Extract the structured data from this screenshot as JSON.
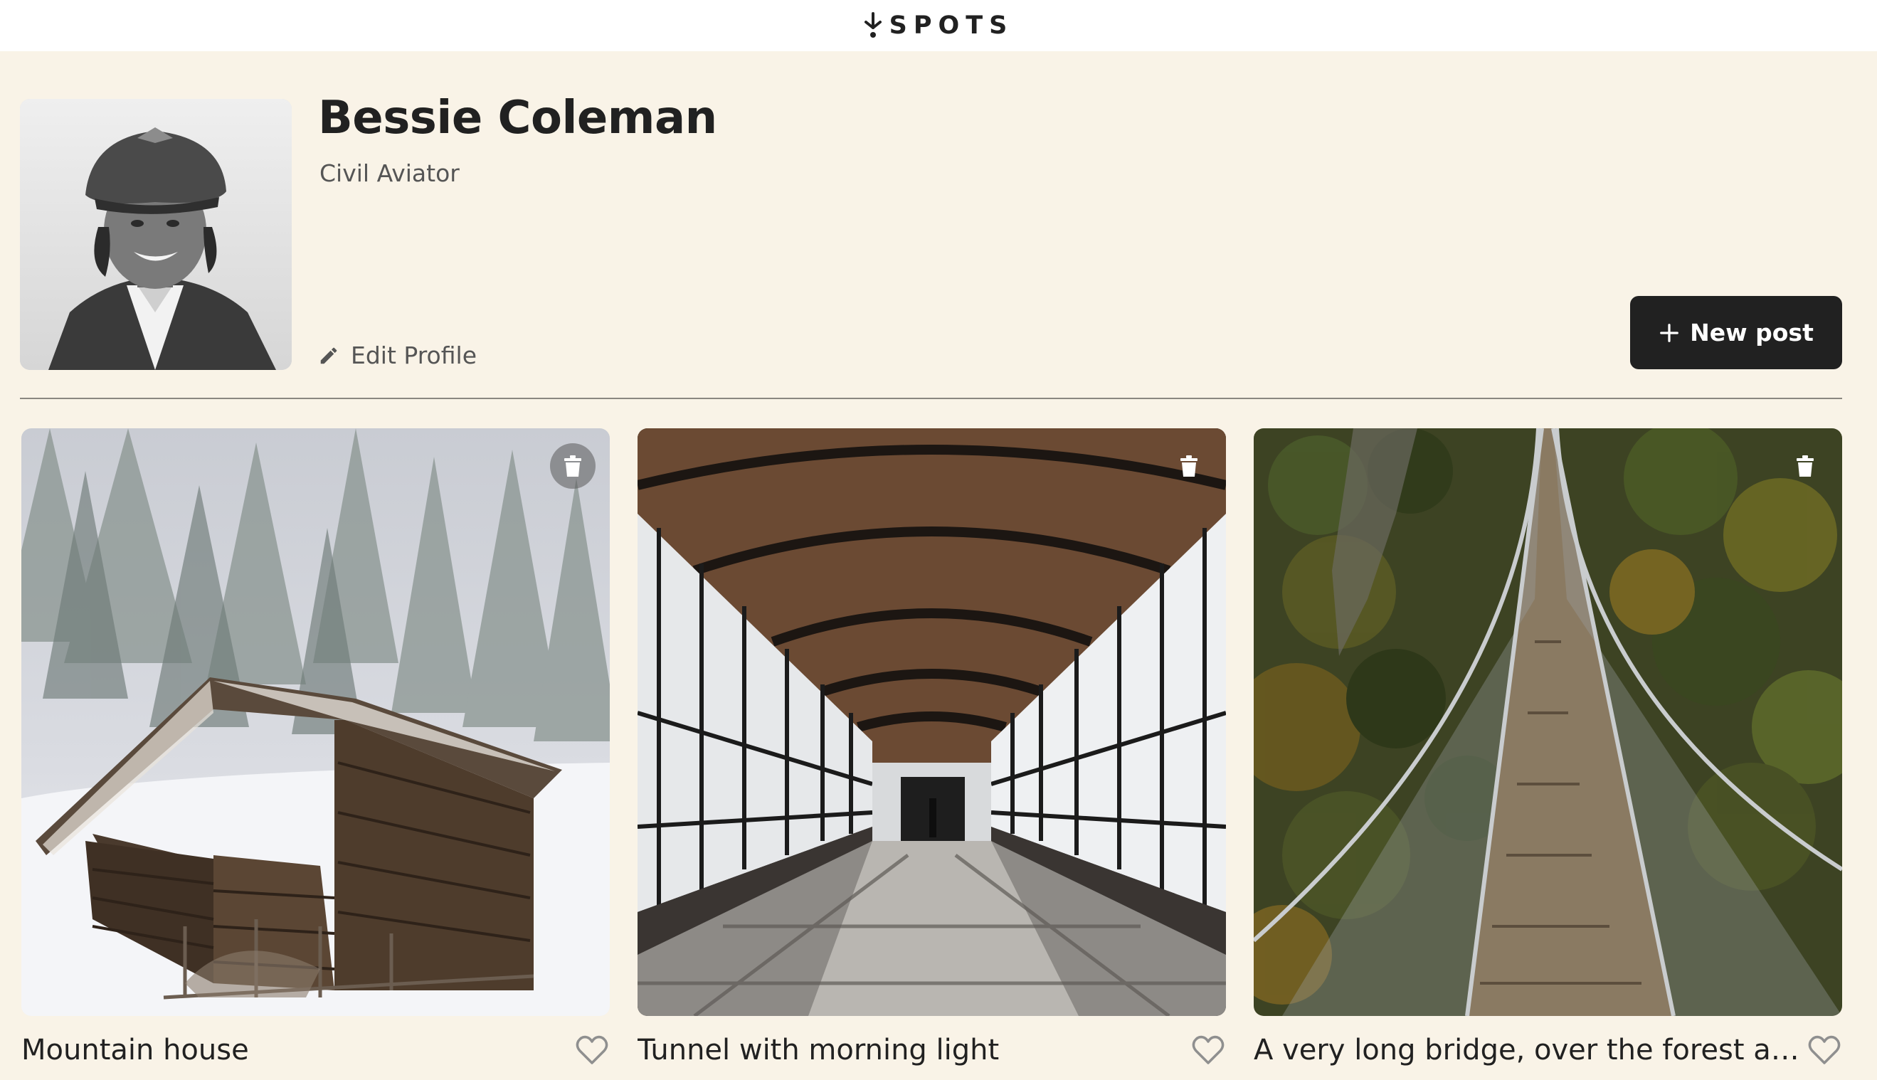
{
  "header": {
    "logo_text": "SPOTS",
    "logo_icon": "spots-logo-mark"
  },
  "profile": {
    "name": "Bessie Coleman",
    "description": "Civil Aviator",
    "edit_label": "Edit Profile",
    "edit_icon": "pencil-icon",
    "avatar_icon": "avatar-photo"
  },
  "actions": {
    "new_post_label": "New post",
    "new_post_icon": "plus-icon"
  },
  "cards": [
    {
      "title": "Mountain house",
      "delete_icon": "trash-icon",
      "like_icon": "heart-icon",
      "image": "snowy-cabin-photo"
    },
    {
      "title": "Tunnel with morning light",
      "delete_icon": "trash-icon",
      "like_icon": "heart-icon",
      "image": "glass-tunnel-photo"
    },
    {
      "title": "A very long bridge, over the forest an...",
      "delete_icon": "trash-icon",
      "like_icon": "heart-icon",
      "image": "suspension-bridge-photo"
    }
  ],
  "colors": {
    "background": "#f9f3e7",
    "header": "#ffffff",
    "text": "#212121",
    "muted": "#555555",
    "button": "#212121",
    "divider": "#8a8780"
  }
}
